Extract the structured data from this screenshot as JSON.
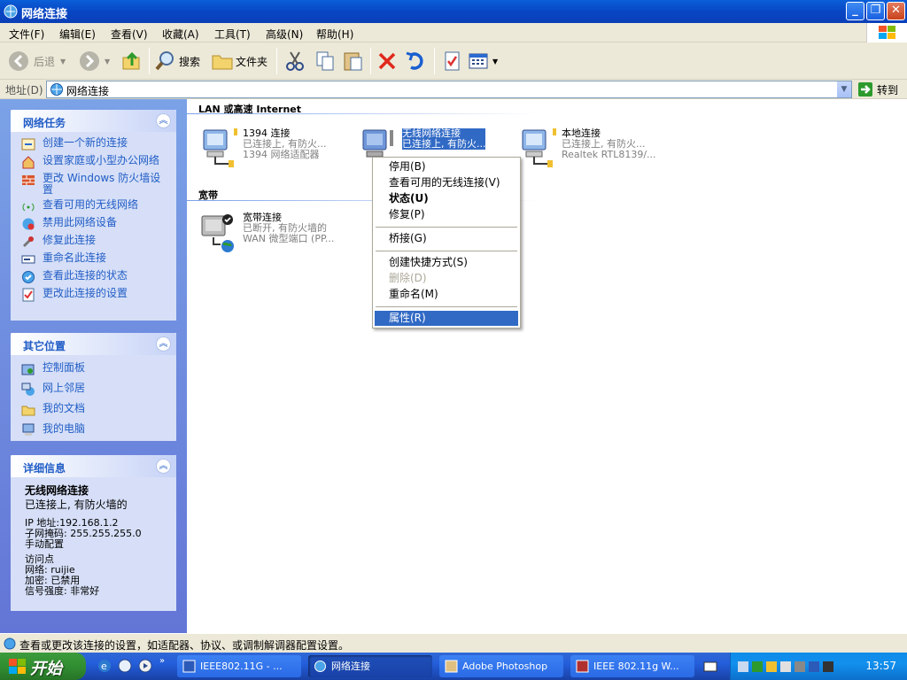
{
  "window": {
    "title": "网络连接"
  },
  "menu": [
    "文件(F)",
    "编辑(E)",
    "查看(V)",
    "收藏(A)",
    "工具(T)",
    "高级(N)",
    "帮助(H)"
  ],
  "toolbar": {
    "back": "后退",
    "search": "搜索",
    "folders": "文件夹"
  },
  "address": {
    "label": "地址(D)",
    "value": "网络连接",
    "go": "转到"
  },
  "left": {
    "tasks_title": "网络任务",
    "tasks": [
      "创建一个新的连接",
      "设置家庭或小型办公网络",
      "更改 Windows 防火墙设置",
      "查看可用的无线网络",
      "禁用此网络设备",
      "修复此连接",
      "重命名此连接",
      "查看此连接的状态",
      "更改此连接的设置"
    ],
    "places_title": "其它位置",
    "places": [
      "控制面板",
      "网上邻居",
      "我的文档",
      "我的电脑"
    ],
    "details_title": "详细信息",
    "details": {
      "name": "无线网络连接",
      "status": "已连接上, 有防火墙的",
      "ip": "IP 地址:192.168.1.2",
      "mask": "子网掩码: 255.255.255.0",
      "config": "手动配置",
      "ap": "访问点",
      "network": "网络: ruijie",
      "encryption": "加密: 已禁用",
      "signal": "信号强度: 非常好"
    }
  },
  "groups": {
    "lan_title": "LAN 或高速 Internet",
    "broadband_title": "宽带"
  },
  "connections": {
    "c1394": {
      "name": "1394 连接",
      "status": "已连接上, 有防火...",
      "device": "1394 网络适配器"
    },
    "wireless": {
      "name": "无线网络连接",
      "status": "已连接上, 有防火..."
    },
    "local": {
      "name": "本地连接",
      "status": "已连接上, 有防火...",
      "device": "Realtek RTL8139/..."
    },
    "broadband": {
      "name": "宽带连接",
      "status": "已断开, 有防火墙的",
      "device": "WAN 微型端口 (PP..."
    }
  },
  "context_menu": {
    "disable": "停用(B)",
    "view_wireless": "查看可用的无线连接(V)",
    "status": "状态(U)",
    "repair": "修复(P)",
    "bridge": "桥接(G)",
    "shortcut": "创建快捷方式(S)",
    "delete": "删除(D)",
    "rename": "重命名(M)",
    "properties": "属性(R)"
  },
  "status_bar": "查看或更改该连接的设置，如适配器、协议、或调制解调器配置设置。",
  "taskbar": {
    "start": "开始",
    "buttons": [
      "IEEE802.11G - ...",
      "网络连接",
      "Adobe Photoshop",
      "IEEE 802.11g W..."
    ],
    "clock": "13:57"
  },
  "colors": {
    "accent": "#316ac5",
    "link": "#215dc6",
    "xp_blue": "#0846c4"
  }
}
